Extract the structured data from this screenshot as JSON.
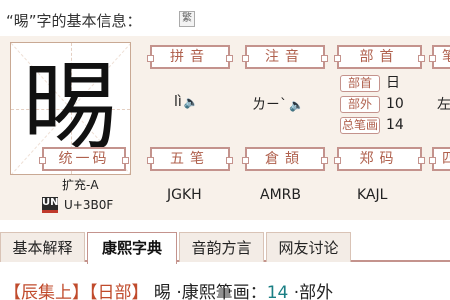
{
  "header": {
    "title": "“晹”字的基本信息：",
    "fan_icon": "繁"
  },
  "glyph": "晹",
  "labels": {
    "pinyin": "拼音",
    "zhuyin": "注音",
    "bushou": "部首",
    "next": "笔",
    "tongyima": "统一码",
    "wubi": "五笔",
    "cangjie": "倉頡",
    "zhengma": "郑码",
    "next2": "四"
  },
  "pinyin": {
    "value": "lì"
  },
  "zhuyin": {
    "value": "ㄌㄧˋ"
  },
  "bushou": {
    "rows": [
      {
        "tag": "部首",
        "value": "日"
      },
      {
        "tag": "部外",
        "value": "10"
      },
      {
        "tag": "总笔画",
        "value": "14"
      }
    ],
    "overflow": "左"
  },
  "unicode": {
    "ext": "扩充-A",
    "logo": "UN",
    "code": "U+3B0F"
  },
  "wubi": "JGKH",
  "cangjie": "AMRB",
  "zhengma": "KAJL",
  "tabs": [
    {
      "label": "基本解释",
      "active": false
    },
    {
      "label": "康熙字典",
      "active": true
    },
    {
      "label": "音韵方言",
      "active": false
    },
    {
      "label": "网友讨论",
      "active": false
    }
  ],
  "content": {
    "chen": "【辰集上】",
    "ri": "【日部】",
    "char": "晹",
    "bihua_label": "·康熙筆画：",
    "bihua_value": "14",
    "buwai_label": "·部外"
  },
  "icons": {
    "speaker": "speaker-icon",
    "fan": "traditional-toggle-icon",
    "unicode_logo": "unicode-logo-icon"
  },
  "colors": {
    "accent": "#b0614e",
    "border": "#c4938d",
    "panel_bg": "#f8f1ea",
    "link": "#c04b2c",
    "number": "#1a7f84"
  }
}
